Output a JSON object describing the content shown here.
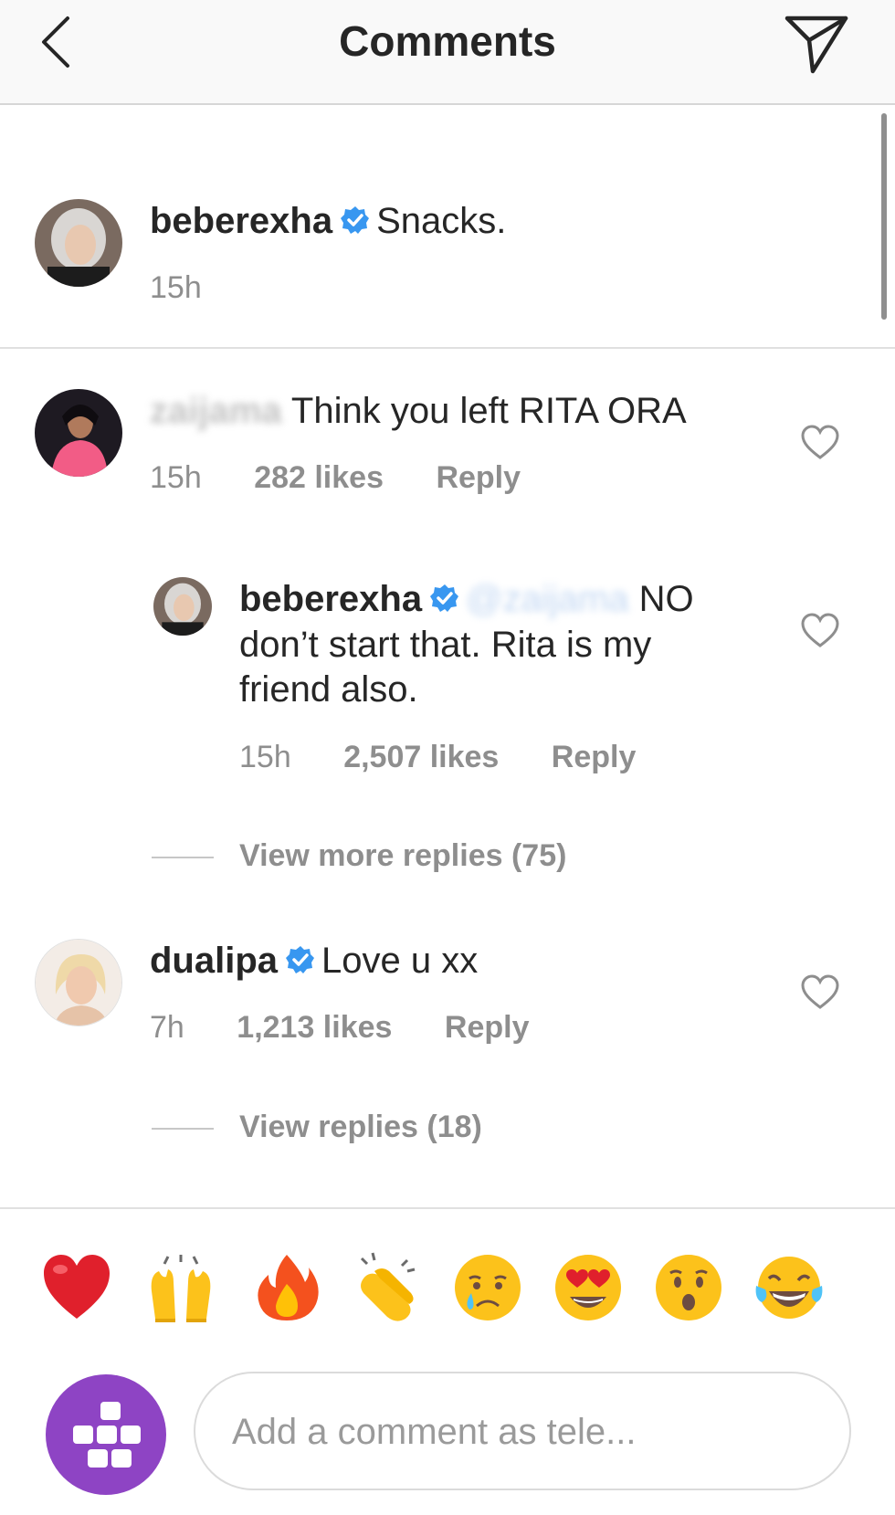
{
  "header": {
    "title": "Comments"
  },
  "caption": {
    "username": "beberexha",
    "text": "Snacks.",
    "time": "15h"
  },
  "comments": [
    {
      "username": "zaijama",
      "text": "Think you left RITA ORA",
      "time": "15h",
      "likes": "282 likes",
      "reply_label": "Reply"
    },
    {
      "username": "beberexha",
      "mention": "@zaijama",
      "text_first": "NO",
      "text_rest_1": "don’t start that. Rita is my",
      "text_rest_2": "friend also.",
      "time": "15h",
      "likes": "2,507 likes",
      "reply_label": "Reply"
    },
    {
      "username": "dualipa",
      "text": "Love u xx",
      "time": "7h",
      "likes": "1,213 likes",
      "reply_label": "Reply"
    }
  ],
  "view_more_replies": "View more replies (75)",
  "view_replies": "View replies (18)",
  "emoji_bar": [
    "heart",
    "raising-hands",
    "fire",
    "clapping-hands",
    "crying-face",
    "heart-eyes-face",
    "surprised-face",
    "tears-of-joy-face"
  ],
  "comment_input": {
    "placeholder": "Add a comment as tele..."
  },
  "colors": {
    "verified": "#3897f0",
    "muted": "#8e8e8e",
    "text": "#262626",
    "user_avatar": "#8e44c4"
  }
}
